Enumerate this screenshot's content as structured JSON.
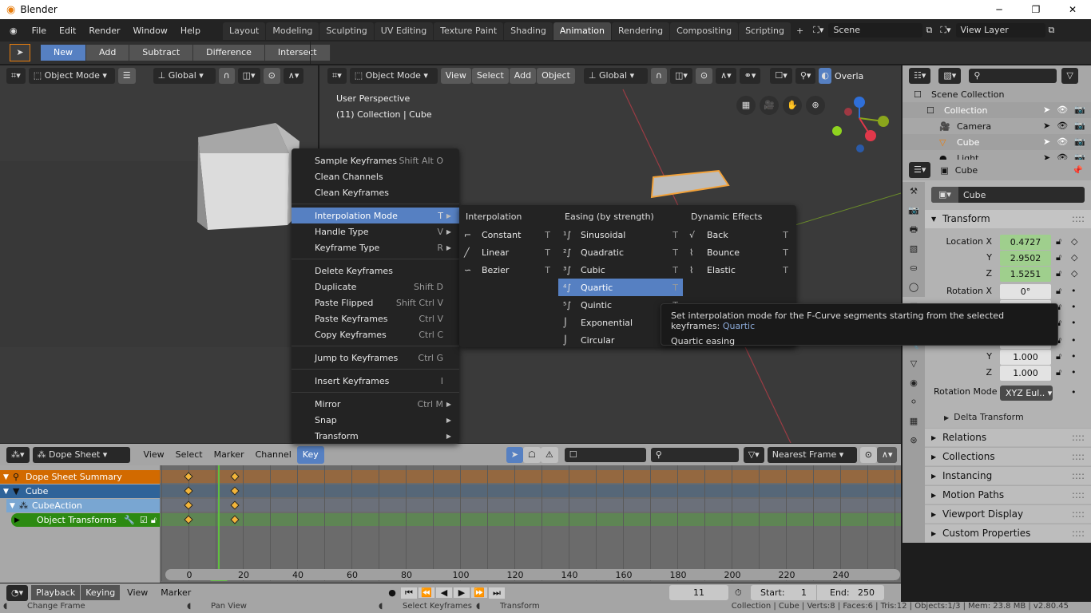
{
  "window": {
    "title": "Blender",
    "controls": [
      "minimize-icon",
      "maximize-icon",
      "close-icon"
    ]
  },
  "topbar": {
    "menus": [
      "File",
      "Edit",
      "Render",
      "Window",
      "Help"
    ],
    "tabs": [
      "Layout",
      "Modeling",
      "Sculpting",
      "UV Editing",
      "Texture Paint",
      "Shading",
      "Animation",
      "Rendering",
      "Compositing",
      "Scripting"
    ],
    "active_tab": "Animation",
    "add_tab": "+",
    "scene": "Scene",
    "view_layer": "View Layer"
  },
  "toolheader": {
    "modes": [
      "New",
      "Add",
      "Subtract",
      "Difference",
      "Intersect"
    ],
    "active": "New"
  },
  "left_viewport": {
    "mode": "Object Mode",
    "orientation": "Global"
  },
  "viewport": {
    "mode": "Object Mode",
    "menus": [
      "View",
      "Select",
      "Add",
      "Object"
    ],
    "orientation": "Global",
    "overlays": "Overla",
    "perspective": "User Perspective",
    "collection_info": "(11) Collection | Cube"
  },
  "key_menu": {
    "items": [
      {
        "label": "Sample Keyframes",
        "shortcut": "Shift Alt O"
      },
      {
        "label": "Clean Channels",
        "shortcut": ""
      },
      {
        "label": "Clean Keyframes",
        "shortcut": ""
      },
      {
        "sep": true
      },
      {
        "label": "Interpolation Mode",
        "shortcut": "T",
        "submenu": true,
        "highlighted": true
      },
      {
        "label": "Handle Type",
        "shortcut": "V",
        "submenu": true
      },
      {
        "label": "Keyframe Type",
        "shortcut": "R",
        "submenu": true
      },
      {
        "sep": true
      },
      {
        "label": "Delete Keyframes",
        "shortcut": ""
      },
      {
        "label": "Duplicate",
        "shortcut": "Shift D"
      },
      {
        "label": "Paste Flipped",
        "shortcut": "Shift Ctrl V"
      },
      {
        "label": "Paste Keyframes",
        "shortcut": "Ctrl V"
      },
      {
        "label": "Copy Keyframes",
        "shortcut": "Ctrl C"
      },
      {
        "sep": true
      },
      {
        "label": "Jump to Keyframes",
        "shortcut": "Ctrl G"
      },
      {
        "sep": true
      },
      {
        "label": "Insert Keyframes",
        "shortcut": "I"
      },
      {
        "sep": true
      },
      {
        "label": "Mirror",
        "shortcut": "Ctrl M",
        "submenu": true
      },
      {
        "label": "Snap",
        "shortcut": "",
        "submenu": true
      },
      {
        "label": "Transform",
        "shortcut": "",
        "submenu": true
      }
    ]
  },
  "interp_submenu": {
    "columns": [
      {
        "header": "Interpolation",
        "items": [
          {
            "label": "Constant",
            "icon": "constant-icon",
            "glyph": "⌐",
            "shortcut": "T"
          },
          {
            "label": "Linear",
            "icon": "linear-icon",
            "glyph": "╱",
            "shortcut": "T"
          },
          {
            "label": "Bezier",
            "icon": "bezier-icon",
            "glyph": "∽",
            "shortcut": "T"
          }
        ]
      },
      {
        "header": "Easing (by strength)",
        "items": [
          {
            "label": "Sinusoidal",
            "icon": "sinusoidal-icon",
            "glyph": "¹∫",
            "shortcut": "T"
          },
          {
            "label": "Quadratic",
            "icon": "quadratic-icon",
            "glyph": "²∫",
            "shortcut": "T"
          },
          {
            "label": "Cubic",
            "icon": "cubic-icon",
            "glyph": "³∫",
            "shortcut": "T"
          },
          {
            "label": "Quartic",
            "icon": "quartic-icon",
            "glyph": "⁴∫",
            "shortcut": "T",
            "highlighted": true
          },
          {
            "label": "Quintic",
            "icon": "quintic-icon",
            "glyph": "⁵∫",
            "shortcut": "T"
          },
          {
            "label": "Exponential",
            "icon": "exponential-icon",
            "glyph": "⌡",
            "shortcut": ""
          },
          {
            "label": "Circular",
            "icon": "circular-icon",
            "glyph": "⌡",
            "shortcut": ""
          }
        ]
      },
      {
        "header": "Dynamic Effects",
        "items": [
          {
            "label": "Back",
            "icon": "back-icon",
            "glyph": "√",
            "shortcut": "T"
          },
          {
            "label": "Bounce",
            "icon": "bounce-icon",
            "glyph": "⌇",
            "shortcut": "T"
          },
          {
            "label": "Elastic",
            "icon": "elastic-icon",
            "glyph": "⌇",
            "shortcut": "T"
          }
        ]
      }
    ]
  },
  "tooltip": {
    "text": "Set interpolation mode for the F-Curve segments starting from the selected keyframes:",
    "value": "Quartic",
    "subtext": "Quartic easing"
  },
  "outliner": {
    "items": [
      {
        "label": "Scene Collection",
        "depth": 0
      },
      {
        "label": "Collection",
        "depth": 1
      },
      {
        "label": "Camera",
        "depth": 2
      },
      {
        "label": "Cube",
        "depth": 2
      },
      {
        "label": "Light",
        "depth": 2
      }
    ]
  },
  "properties": {
    "object_name": "Cube",
    "data_name": "Cube",
    "transform_title": "Transform",
    "rows": [
      {
        "label": "Location X",
        "value": "0.4727",
        "keyed": true
      },
      {
        "label": "Y",
        "value": "2.9502",
        "keyed": true
      },
      {
        "label": "Z",
        "value": "1.5251",
        "keyed": true
      },
      {
        "label": "Rotation X",
        "value": "0°"
      },
      {
        "label": "Y",
        "value": "0°"
      },
      {
        "label": "Z",
        "value": "0°"
      },
      {
        "label": "Scale X",
        "value": "1.000"
      },
      {
        "label": "Y",
        "value": "1.000"
      },
      {
        "label": "Z",
        "value": "1.000"
      }
    ],
    "rotation_mode_label": "Rotation Mode",
    "rotation_mode": "XYZ Eul..",
    "delta": "Delta Transform",
    "panels": [
      "Relations",
      "Collections",
      "Instancing",
      "Motion Paths",
      "Viewport Display",
      "Custom Properties"
    ]
  },
  "dopesheet": {
    "editor": "Dope Sheet",
    "menus": [
      "View",
      "Select",
      "Marker",
      "Channel",
      "Key"
    ],
    "active_menu": "Key",
    "snap": "Nearest Frame",
    "channels": [
      {
        "label": "Dope Sheet Summary",
        "color": "#d26a00"
      },
      {
        "label": "Cube",
        "color": "#2f6399"
      },
      {
        "label": "CubeAction",
        "color": "#79a6d2"
      },
      {
        "label": "Object Transforms",
        "color": "#2c8a12"
      }
    ],
    "row_colors": [
      "#946840",
      "#566778",
      "#6b707a",
      "#5e8554"
    ],
    "keyframes": [
      0,
      17
    ],
    "current_frame": 11,
    "ticks": [
      0,
      20,
      40,
      60,
      80,
      100,
      120,
      140,
      160,
      180,
      200,
      220,
      240
    ]
  },
  "timeline": {
    "menus": [
      "Playback",
      "Keying",
      "View",
      "Marker"
    ],
    "frame": "11",
    "start_label": "Start:",
    "start": "1",
    "end_label": "End:",
    "end": "250"
  },
  "status": {
    "left": [
      "Change Frame",
      "Pan View",
      "Select Keyframes",
      "Transform"
    ],
    "right": "Collection | Cube | Verts:8 | Faces:6 | Tris:12 | Objects:1/3 | Mem: 23.8 MB | v2.80.45"
  }
}
